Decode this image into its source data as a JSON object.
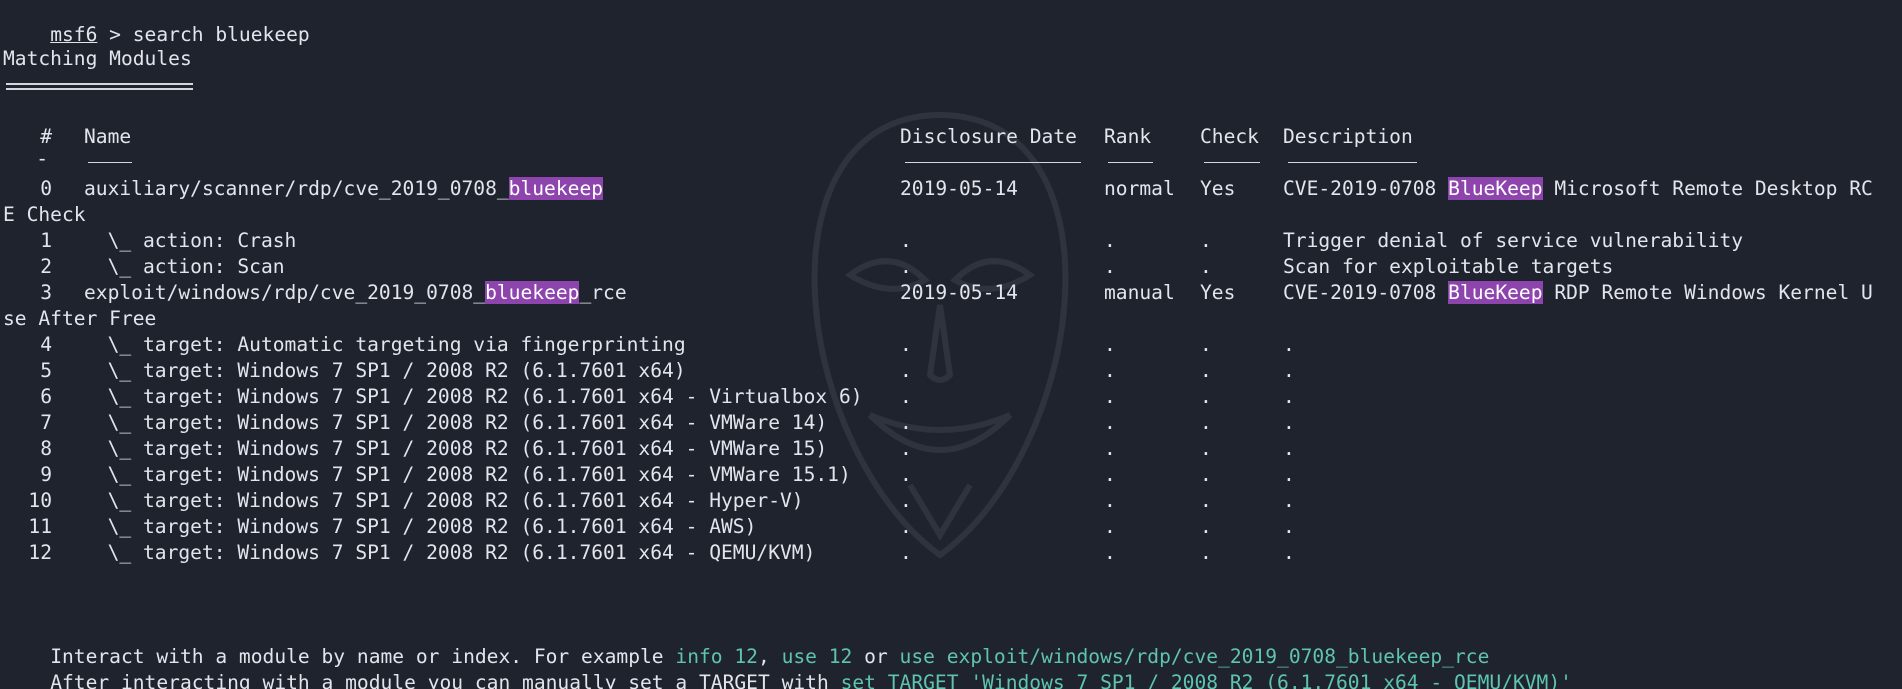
{
  "prompt": {
    "name": "msf6",
    "separator": " > ",
    "command": "search bluekeep"
  },
  "section_title": "Matching Modules",
  "headers": {
    "idx": "#",
    "name": "Name",
    "date": "Disclosure Date",
    "rank": "Rank",
    "check": "Check",
    "desc": "Description"
  },
  "header_rule_idx": "-",
  "rows": [
    {
      "idx": "0",
      "name_pre": "auxiliary/scanner/rdp/cve_2019_0708_",
      "name_hl": "bluekeep",
      "name_post": "",
      "date": "2019-05-14",
      "rank": "normal",
      "check": "Yes",
      "desc_pre": "CVE-2019-0708 ",
      "desc_hl": "BlueKeep",
      "desc_post": " Microsoft Remote Desktop RC",
      "wrap": "E Check"
    },
    {
      "idx": "1",
      "name_pre": "  \\_ action: Crash",
      "date": ".",
      "rank": ".",
      "check": ".",
      "desc_pre": "Trigger denial of service vulnerability"
    },
    {
      "idx": "2",
      "name_pre": "  \\_ action: Scan",
      "date": ".",
      "rank": ".",
      "check": ".",
      "desc_pre": "Scan for exploitable targets"
    },
    {
      "idx": "3",
      "name_pre": "exploit/windows/rdp/cve_2019_0708_",
      "name_hl": "bluekeep",
      "name_post": "_rce",
      "date": "2019-05-14",
      "rank": "manual",
      "check": "Yes",
      "desc_pre": "CVE-2019-0708 ",
      "desc_hl": "BlueKeep",
      "desc_post": " RDP Remote Windows Kernel U",
      "wrap": "se After Free"
    },
    {
      "idx": "4",
      "name_pre": "  \\_ target: Automatic targeting via fingerprinting",
      "date": ".",
      "rank": ".",
      "check": ".",
      "desc_pre": "."
    },
    {
      "idx": "5",
      "name_pre": "  \\_ target: Windows 7 SP1 / 2008 R2 (6.1.7601 x64)",
      "date": ".",
      "rank": ".",
      "check": ".",
      "desc_pre": "."
    },
    {
      "idx": "6",
      "name_pre": "  \\_ target: Windows 7 SP1 / 2008 R2 (6.1.7601 x64 - Virtualbox 6)",
      "date": ".",
      "rank": ".",
      "check": ".",
      "desc_pre": "."
    },
    {
      "idx": "7",
      "name_pre": "  \\_ target: Windows 7 SP1 / 2008 R2 (6.1.7601 x64 - VMWare 14)",
      "date": ".",
      "rank": ".",
      "check": ".",
      "desc_pre": "."
    },
    {
      "idx": "8",
      "name_pre": "  \\_ target: Windows 7 SP1 / 2008 R2 (6.1.7601 x64 - VMWare 15)",
      "date": ".",
      "rank": ".",
      "check": ".",
      "desc_pre": "."
    },
    {
      "idx": "9",
      "name_pre": "  \\_ target: Windows 7 SP1 / 2008 R2 (6.1.7601 x64 - VMWare 15.1)",
      "date": ".",
      "rank": ".",
      "check": ".",
      "desc_pre": "."
    },
    {
      "idx": "10",
      "name_pre": "  \\_ target: Windows 7 SP1 / 2008 R2 (6.1.7601 x64 - Hyper-V)",
      "date": ".",
      "rank": ".",
      "check": ".",
      "desc_pre": "."
    },
    {
      "idx": "11",
      "name_pre": "  \\_ target: Windows 7 SP1 / 2008 R2 (6.1.7601 x64 - AWS)",
      "date": ".",
      "rank": ".",
      "check": ".",
      "desc_pre": "."
    },
    {
      "idx": "12",
      "name_pre": "  \\_ target: Windows 7 SP1 / 2008 R2 (6.1.7601 x64 - QEMU/KVM)",
      "date": ".",
      "rank": ".",
      "check": ".",
      "desc_pre": "."
    }
  ],
  "footer": {
    "line1_a": "Interact with a module by name or index. For example ",
    "line1_cmd1": "info 12",
    "line1_sep1": ", ",
    "line1_cmd2": "use 12",
    "line1_sep2": " or ",
    "line1_cmd3": "use exploit/windows/rdp/cve_2019_0708_bluekeep_rce",
    "line2_a": "After interacting with a module you can manually set a TARGET with ",
    "line2_cmd": "set TARGET 'Windows 7 SP1 / 2008 R2 (6.1.7601 x64 - QEMU/KVM)'"
  },
  "colors": {
    "background": "#1f232e",
    "text": "#e3e5ec",
    "highlight": "#8e44ad",
    "command": "#5ec4b0"
  }
}
